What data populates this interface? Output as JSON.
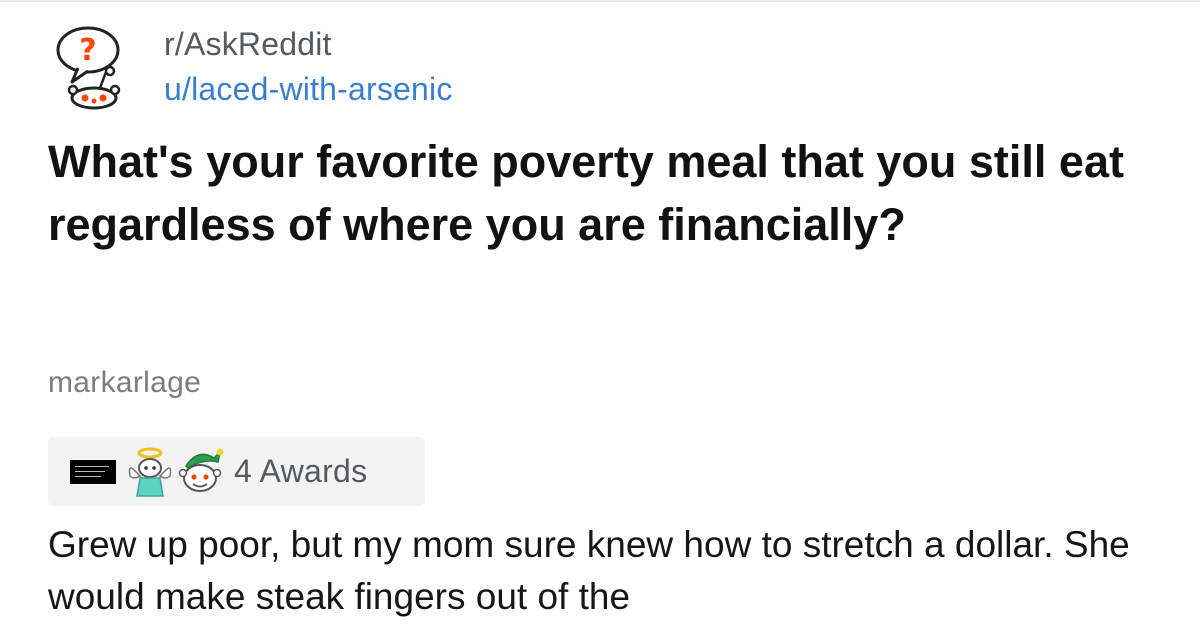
{
  "post": {
    "subreddit": "r/AskReddit",
    "author": "u/laced-with-arsenic",
    "title": "What's your favorite poverty meal that you still eat regardless of where you are financially?"
  },
  "comment": {
    "author": "markarlage",
    "awards_label": "4 Awards",
    "body": "Grew up poor, but my mom sure knew how to stretch a dollar. She would make steak fingers out of the"
  },
  "icons": {
    "subreddit_icon": "askreddit-snoo-question-icon",
    "award_icons": [
      "text-award-icon",
      "angel-award-icon",
      "elf-snoo-award-icon"
    ]
  },
  "colors": {
    "username": "#3a7ed1",
    "meta_text": "#555a5e",
    "commenter": "#7c7c7c",
    "award_bg": "#f3f3f3",
    "snoo_red": "#ff4500"
  }
}
